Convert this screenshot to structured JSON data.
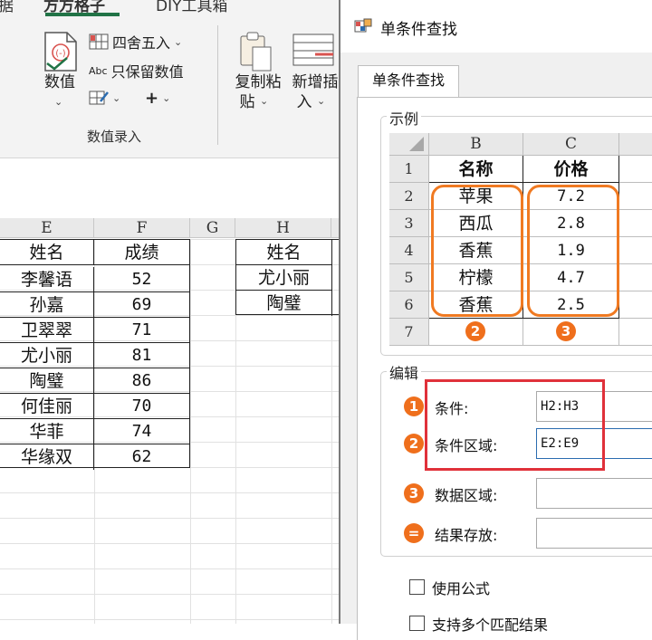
{
  "ribbon": {
    "tabs": [
      "据",
      "方方格子",
      "DIY工具箱"
    ],
    "value_btn": "数值",
    "round_label": "四舍五入",
    "keep_value_label": "只保留数值",
    "abc_label": "Abc",
    "plus_label": "+",
    "group_label": "数值录入",
    "copy_paste_line1": "复制粘",
    "copy_paste_line2": "贴",
    "new_insert_line1": "新增插",
    "new_insert_line2": "入"
  },
  "sheet": {
    "columns": [
      "E",
      "F",
      "G",
      "H"
    ],
    "table_header": [
      "姓名",
      "成绩"
    ],
    "rows": [
      [
        "李馨语",
        "52"
      ],
      [
        "孙嘉",
        "69"
      ],
      [
        "卫翠翠",
        "71"
      ],
      [
        "尤小丽",
        "81"
      ],
      [
        "陶璧",
        "86"
      ],
      [
        "何佳丽",
        "70"
      ],
      [
        "华菲",
        "74"
      ],
      [
        "华缘双",
        "62"
      ]
    ],
    "criteria_header": "姓名",
    "criteria": [
      "尤小丽",
      "陶璧"
    ]
  },
  "dialog": {
    "title": "单条件查找",
    "tab_label": "单条件查找",
    "example_legend": "示例",
    "example": {
      "col_headers": [
        "B",
        "C"
      ],
      "row_numbers": [
        "1",
        "2",
        "3",
        "4",
        "5",
        "6",
        "7"
      ],
      "header": [
        "名称",
        "价格"
      ],
      "rows": [
        [
          "苹果",
          "7.2"
        ],
        [
          "西瓜",
          "2.8"
        ],
        [
          "香蕉",
          "1.9"
        ],
        [
          "柠檬",
          "4.7"
        ],
        [
          "香蕉",
          "2.5"
        ]
      ],
      "badges": [
        "2",
        "3"
      ]
    },
    "edit_legend": "编辑",
    "fields": [
      {
        "badge": "1",
        "label": "条件:",
        "value": "H2:H3"
      },
      {
        "badge": "2",
        "label": "条件区域:",
        "value": "E2:E9"
      },
      {
        "badge": "3",
        "label": "数据区域:",
        "value": ""
      },
      {
        "badge": "=",
        "label": "结果存放:",
        "value": ""
      }
    ],
    "checkboxes": [
      "使用公式",
      "支持多个匹配结果"
    ],
    "accent_orange": "#ef6f1c",
    "highlight_red": "#e0313a"
  }
}
